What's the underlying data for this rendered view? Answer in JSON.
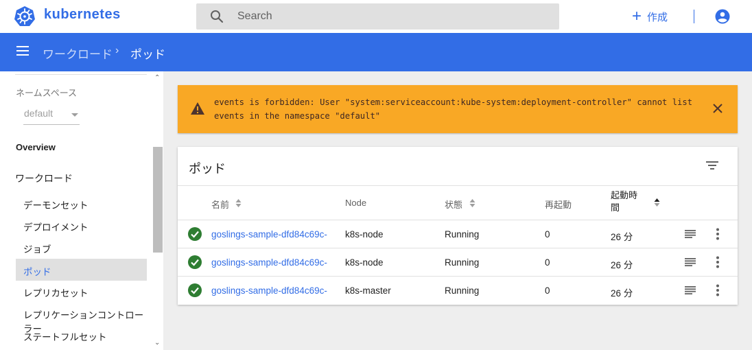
{
  "app": {
    "name": "kubernetes"
  },
  "search": {
    "placeholder": "Search"
  },
  "toolbar": {
    "create_label": "作成"
  },
  "breadcrumb": {
    "parent": "ワークロード",
    "separator": "›",
    "current": "ポッド"
  },
  "sidebar": {
    "namespace_label": "ネームスペース",
    "namespace_value": "default",
    "overview": "Overview",
    "workloads": "ワークロード",
    "items": [
      {
        "label": "デーモンセット",
        "active": false
      },
      {
        "label": "デプロイメント",
        "active": false
      },
      {
        "label": "ジョブ",
        "active": false
      },
      {
        "label": "ポッド",
        "active": true
      },
      {
        "label": "レプリカセット",
        "active": false
      },
      {
        "label": "レプリケーションコントローラー",
        "active": false
      },
      {
        "label": "ステートフルセット",
        "active": false
      }
    ]
  },
  "alert": {
    "type": "warning",
    "message": "events is forbidden: User \"system:serviceaccount:kube-system:deployment-controller\" cannot list events in the namespace \"default\""
  },
  "pods_card": {
    "title": "ポッド",
    "columns": {
      "name": "名前",
      "node": "Node",
      "status": "状態",
      "restarts": "再起動",
      "age": "起動時間"
    },
    "rows": [
      {
        "name": "goslings-sample-dfd84c69c-",
        "node": "k8s-node",
        "status": "Running",
        "restarts": "0",
        "age": "26 分"
      },
      {
        "name": "goslings-sample-dfd84c69c-",
        "node": "k8s-node",
        "status": "Running",
        "restarts": "0",
        "age": "26 分"
      },
      {
        "name": "goslings-sample-dfd84c69c-",
        "node": "k8s-master",
        "status": "Running",
        "restarts": "0",
        "age": "26 分"
      }
    ]
  },
  "colors": {
    "primary": "#326de6",
    "warning": "#f9a825",
    "success": "#2e7d32",
    "background": "#eeeeee"
  }
}
